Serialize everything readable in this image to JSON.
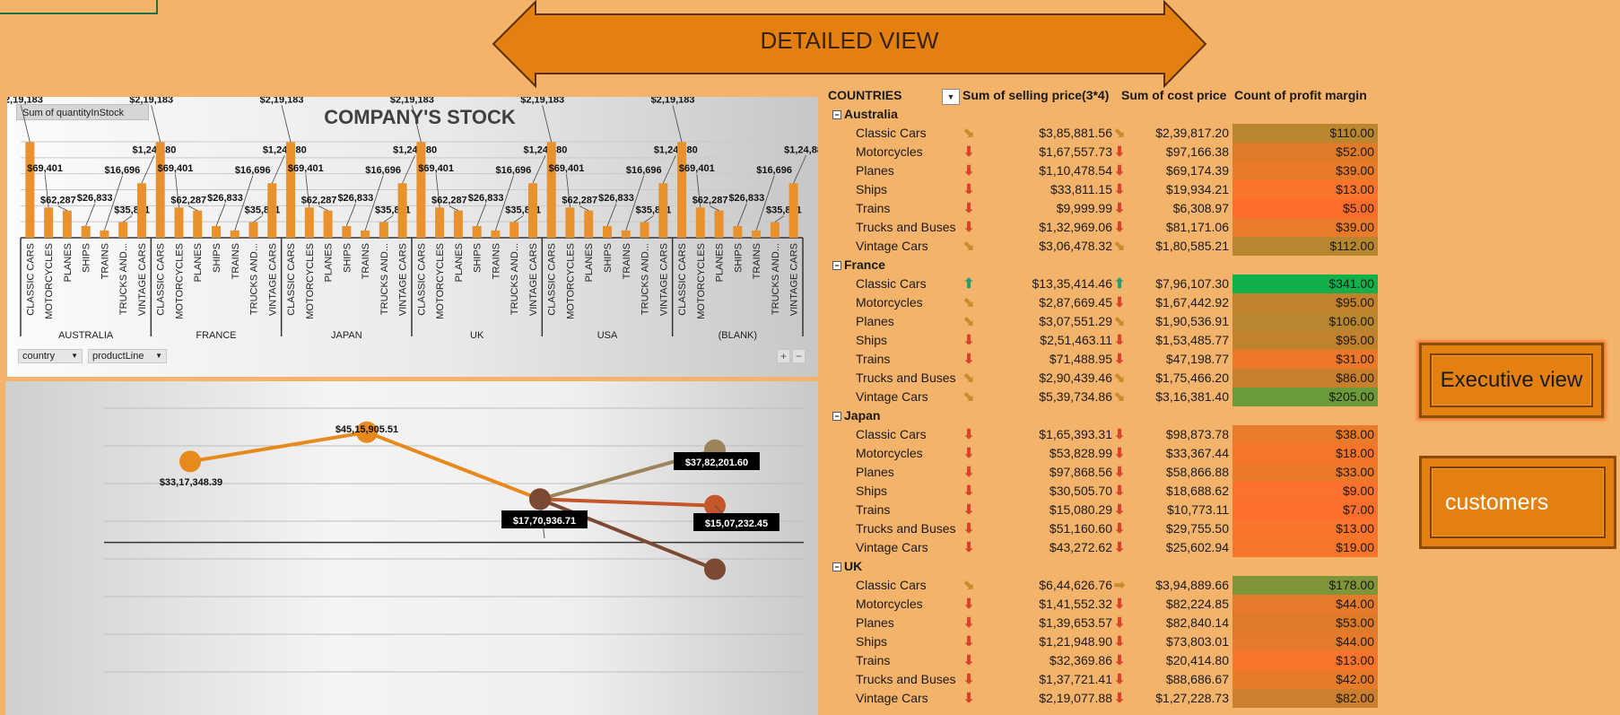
{
  "banner": {
    "label": "DETAILED VIEW"
  },
  "stock_chart": {
    "field_button": "Sum of quantityInStock",
    "filters": [
      "country",
      "productLine"
    ],
    "plus": "+",
    "minus": "−",
    "chart_data": {
      "type": "bar",
      "title": "COMPANY'S STOCK",
      "groups": [
        "AUSTRALIA",
        "FRANCE",
        "JAPAN",
        "UK",
        "USA",
        "(BLANK)"
      ],
      "categories": [
        "CLASSIC CARS",
        "MOTORCYCLES",
        "PLANES",
        "SHIPS",
        "TRAINS",
        "TRUCKS AND...",
        "VINTAGE CARS"
      ],
      "values": [
        219183,
        69401,
        62287,
        26833,
        16696,
        35851,
        124880
      ],
      "value_labels": [
        "$2,19,183",
        "$69,401",
        "$62,287",
        "$26,833",
        "$16,696",
        "$35,851",
        "$1,24,880"
      ],
      "ylim": [
        0,
        220000
      ],
      "color": "#e8912d"
    }
  },
  "line_chart": {
    "chart_data": {
      "type": "line",
      "x": [
        1,
        2,
        3,
        4
      ],
      "ylim": [
        -7000000,
        5500000
      ],
      "series": [
        {
          "color": "#e8891e",
          "values": [
            3317348.39,
            4515905.51,
            1770936.71,
            null
          ],
          "labels": [
            "$33,17,348.39",
            "$45,15,905.51",
            "$17,70,936.71",
            ""
          ]
        },
        {
          "color": "#9b8459",
          "values": [
            null,
            null,
            1770936.71,
            3782201.6
          ],
          "labels": [
            "",
            "",
            "",
            "$37,82,201.60"
          ]
        },
        {
          "color": "#c4562a",
          "values": [
            null,
            null,
            1770936.71,
            1507232.45
          ],
          "labels": [
            "",
            "",
            "",
            "$15,07,232.45"
          ]
        },
        {
          "color": "#7c4a33",
          "values": [
            null,
            null,
            1770936.71,
            -1100000
          ],
          "labels": [
            "",
            "",
            "",
            ""
          ]
        }
      ]
    }
  },
  "pivot": {
    "headers": {
      "countries": "COUNTRIES",
      "selling": "Sum of selling price(3*4)",
      "cost": "Sum of cost price",
      "count": "Count of profit margin"
    },
    "groups": [
      {
        "name": "Australia",
        "rows": [
          {
            "label": "Classic Cars",
            "sell": "$3,85,881.56",
            "cost": "$2,39,817.20",
            "count": "$110.00",
            "icon": "side",
            "icon2": "side",
            "color": "#b9872f"
          },
          {
            "label": "Motorcycles",
            "sell": "$1,67,557.73",
            "cost": "$97,166.38",
            "count": "$52.00",
            "icon": "down",
            "icon2": "down",
            "color": "#df7a28"
          },
          {
            "label": "Planes",
            "sell": "$1,10,478.54",
            "cost": "$69,174.39",
            "count": "$39.00",
            "icon": "down",
            "icon2": "down",
            "color": "#e87b2a"
          },
          {
            "label": "Ships",
            "sell": "$33,811.15",
            "cost": "$19,934.21",
            "count": "$13.00",
            "icon": "down",
            "icon2": "down",
            "color": "#fa742b"
          },
          {
            "label": "Trains",
            "sell": "$9,999.99",
            "cost": "$6,308.97",
            "count": "$5.00",
            "icon": "down",
            "icon2": "down",
            "color": "#fe6d2c"
          },
          {
            "label": "Trucks and Buses",
            "sell": "$1,32,969.06",
            "cost": "$81,171.06",
            "count": "$39.00",
            "icon": "down",
            "icon2": "down",
            "color": "#e97b2a"
          },
          {
            "label": "Vintage Cars",
            "sell": "$3,06,478.32",
            "cost": "$1,80,585.21",
            "count": "$112.00",
            "icon": "side",
            "icon2": "side",
            "color": "#b6872f"
          }
        ]
      },
      {
        "name": "France",
        "rows": [
          {
            "label": "Classic Cars",
            "sell": "$13,35,414.46",
            "cost": "$7,96,107.30",
            "count": "$341.00",
            "icon": "up",
            "icon2": "up",
            "color": "#11b04a"
          },
          {
            "label": "Motorcycles",
            "sell": "$2,87,669.45",
            "cost": "$1,67,442.92",
            "count": "$95.00",
            "icon": "side",
            "icon2": "down",
            "color": "#c2822d"
          },
          {
            "label": "Planes",
            "sell": "$3,07,551.29",
            "cost": "$1,90,536.91",
            "count": "$106.00",
            "icon": "side",
            "icon2": "side",
            "color": "#b8862f"
          },
          {
            "label": "Ships",
            "sell": "$2,51,463.11",
            "cost": "$1,53,485.77",
            "count": "$95.00",
            "icon": "down",
            "icon2": "down",
            "color": "#c2822d"
          },
          {
            "label": "Trains",
            "sell": "$71,488.95",
            "cost": "$47,198.77",
            "count": "$31.00",
            "icon": "down",
            "icon2": "down",
            "color": "#ee782a"
          },
          {
            "label": "Trucks and Buses",
            "sell": "$2,90,439.46",
            "cost": "$1,75,466.20",
            "count": "$86.00",
            "icon": "side",
            "icon2": "side",
            "color": "#c8802c"
          },
          {
            "label": "Vintage Cars",
            "sell": "$5,39,734.86",
            "cost": "$3,16,381.40",
            "count": "$205.00",
            "icon": "side",
            "icon2": "side",
            "color": "#6b9a3a"
          }
        ]
      },
      {
        "name": "Japan",
        "rows": [
          {
            "label": "Classic Cars",
            "sell": "$1,65,393.31",
            "cost": "$98,873.78",
            "count": "$38.00",
            "icon": "down",
            "icon2": "down",
            "color": "#e97b2a"
          },
          {
            "label": "Motorcycles",
            "sell": "$53,828.99",
            "cost": "$33,367.44",
            "count": "$18.00",
            "icon": "down",
            "icon2": "down",
            "color": "#f6752b"
          },
          {
            "label": "Planes",
            "sell": "$97,868.56",
            "cost": "$58,866.88",
            "count": "$33.00",
            "icon": "down",
            "icon2": "down",
            "color": "#ec792a"
          },
          {
            "label": "Ships",
            "sell": "$30,505.70",
            "cost": "$18,688.62",
            "count": "$9.00",
            "icon": "down",
            "icon2": "down",
            "color": "#fc712c"
          },
          {
            "label": "Trains",
            "sell": "$15,080.29",
            "cost": "$10,773.11",
            "count": "$7.00",
            "icon": "down",
            "icon2": "down",
            "color": "#fd6f2c"
          },
          {
            "label": "Trucks and Buses",
            "sell": "$51,160.60",
            "cost": "$29,755.50",
            "count": "$13.00",
            "icon": "down",
            "icon2": "down",
            "color": "#fa742b"
          },
          {
            "label": "Vintage Cars",
            "sell": "$43,272.62",
            "cost": "$25,602.94",
            "count": "$19.00",
            "icon": "down",
            "icon2": "down",
            "color": "#f6752b"
          }
        ]
      },
      {
        "name": "UK",
        "rows": [
          {
            "label": "Classic Cars",
            "sell": "$6,44,626.76",
            "cost": "$3,94,889.66",
            "count": "$178.00",
            "icon": "side",
            "icon2": "right",
            "color": "#7f9538"
          },
          {
            "label": "Motorcycles",
            "sell": "$1,41,552.32",
            "cost": "$82,224.85",
            "count": "$44.00",
            "icon": "down",
            "icon2": "down",
            "color": "#e57b2a"
          },
          {
            "label": "Planes",
            "sell": "$1,39,653.57",
            "cost": "$82,840.14",
            "count": "$53.00",
            "icon": "down",
            "icon2": "down",
            "color": "#df7a28"
          },
          {
            "label": "Ships",
            "sell": "$1,21,948.90",
            "cost": "$73,803.01",
            "count": "$44.00",
            "icon": "down",
            "icon2": "down",
            "color": "#e57b2a"
          },
          {
            "label": "Trains",
            "sell": "$32,369.86",
            "cost": "$20,414.80",
            "count": "$13.00",
            "icon": "down",
            "icon2": "down",
            "color": "#fa742b"
          },
          {
            "label": "Trucks and Buses",
            "sell": "$1,37,721.41",
            "cost": "$88,686.67",
            "count": "$42.00",
            "icon": "down",
            "icon2": "down",
            "color": "#e67b2a"
          },
          {
            "label": "Vintage Cars",
            "sell": "$2,19,077.88",
            "cost": "$1,27,228.73",
            "count": "$82.00",
            "icon": "down",
            "icon2": "down",
            "color": "#cc7f2c"
          }
        ]
      }
    ]
  },
  "buttons": {
    "executive": "Executive view",
    "customers": "customers"
  }
}
